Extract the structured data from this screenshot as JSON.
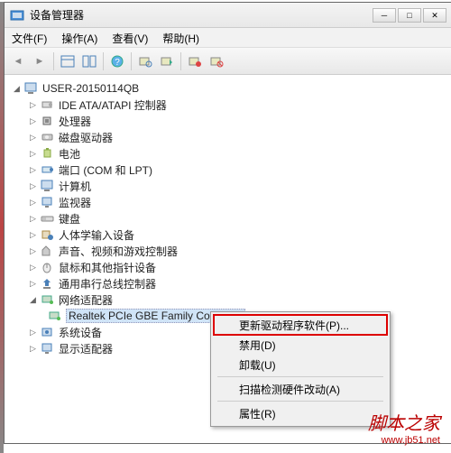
{
  "title": "设备管理器",
  "menus": {
    "file": "文件(F)",
    "action": "操作(A)",
    "view": "查看(V)",
    "help": "帮助(H)"
  },
  "root": "USER-20150114QB",
  "cats": [
    "IDE ATA/ATAPI 控制器",
    "处理器",
    "磁盘驱动器",
    "电池",
    "端口 (COM 和 LPT)",
    "计算机",
    "监视器",
    "键盘",
    "人体学输入设备",
    "声音、视频和游戏控制器",
    "鼠标和其他指针设备",
    "通用串行总线控制器"
  ],
  "netcat": "网络适配器",
  "netdev": "Realtek PCIe GBE Family Controller",
  "tail": [
    "系统设备",
    "显示适配器"
  ],
  "ctx": {
    "update": "更新驱动程序软件(P)...",
    "disable": "禁用(D)",
    "uninstall": "卸载(U)",
    "scan": "扫描检测硬件改动(A)",
    "prop": "属性(R)"
  },
  "wm": {
    "text": "脚本之家",
    "url": "www.jb51.net"
  }
}
